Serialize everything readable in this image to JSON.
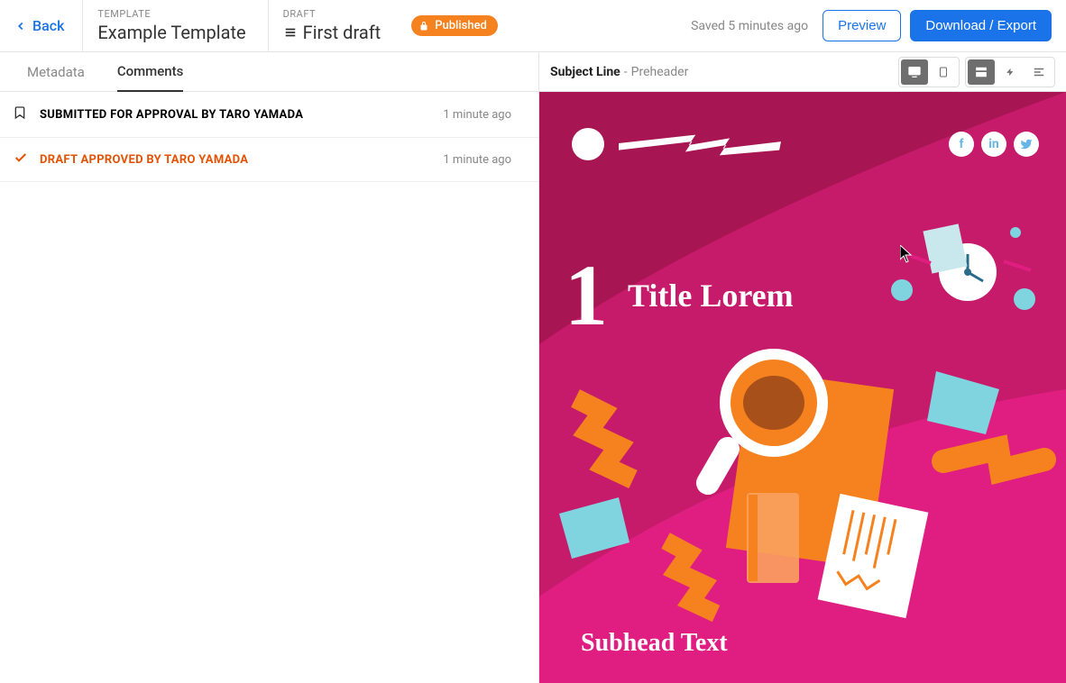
{
  "header": {
    "back": "Back",
    "template_label": "TEMPLATE",
    "template_name": "Example Template",
    "draft_label": "DRAFT",
    "draft_name": "First draft",
    "published_badge": "Published",
    "saved_text": "Saved 5 minutes ago",
    "preview_btn": "Preview",
    "download_btn": "Download / Export"
  },
  "tabs": {
    "metadata": "Metadata",
    "comments": "Comments"
  },
  "activities": [
    {
      "icon": "bookmark",
      "text": "SUBMITTED FOR APPROVAL BY TARO YAMADA",
      "time": "1 minute ago",
      "approved": false
    },
    {
      "icon": "check",
      "text": "DRAFT APPROVED BY TARO YAMADA",
      "time": "1 minute ago",
      "approved": true
    }
  ],
  "subject": {
    "label": "Subject Line",
    "separator": " - ",
    "preheader": "Preheader"
  },
  "email": {
    "number": "1",
    "title": "Title Lorem",
    "subhead": "Subhead Text"
  },
  "social_icons": [
    "facebook",
    "linkedin",
    "twitter"
  ],
  "colors": {
    "brand_pink_dark": "#a71552",
    "brand_pink": "#c61b6a",
    "brand_magenta": "#e01e82",
    "orange": "#f5821f",
    "teal": "#7fd4df"
  }
}
